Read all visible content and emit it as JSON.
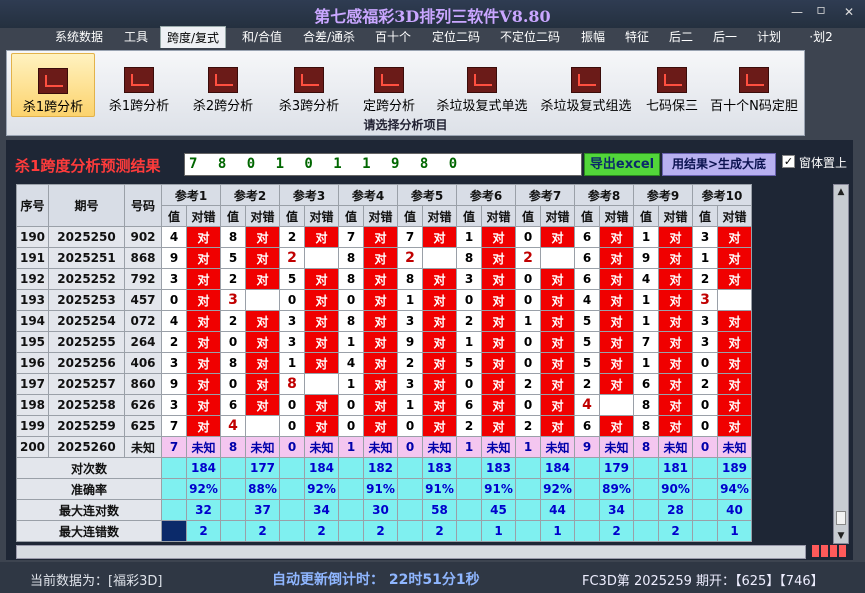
{
  "window": {
    "title": "第七感福彩3D排列三软件V8.80",
    "minimize": "—",
    "restore": "▫",
    "close": "✕"
  },
  "menu": [
    "系统数据",
    "工具",
    "跨度/复式",
    "和/合值",
    "合差/通杀",
    "百十个",
    "定位二码",
    "不定位二码",
    "振幅",
    "特征",
    "后二",
    "后一",
    "计划",
    "·划2"
  ],
  "menu_active": "跨度/复式",
  "ribbon": {
    "buttons": [
      "杀1跨分析",
      "杀1跨分析",
      "杀2跨分析",
      "杀3跨分析",
      "定跨分析",
      "杀垃圾复式单选",
      "杀垃圾复式组选",
      "七码保三",
      "百十个N码定胆"
    ],
    "selected": "杀1跨分析",
    "caption": "请选择分析项目"
  },
  "result": {
    "label": "杀1跨度分析预测结果",
    "value": "7 8 0 1 0 1 1 9 8 0",
    "excel_button": "导出excel",
    "generate_button": "用结果>生成大底",
    "pin_label": "窗体置上",
    "pin_checked": "✓"
  },
  "table": {
    "headers": {
      "seq": "序号",
      "issue": "期号",
      "number": "号码",
      "val": "值",
      "ok": "对错"
    },
    "refs": [
      "参考1",
      "参考2",
      "参考3",
      "参考4",
      "参考5",
      "参考6",
      "参考7",
      "参考8",
      "参考9",
      "参考10"
    ],
    "rows": [
      {
        "seq": "190",
        "issue": "2025250",
        "number": "902",
        "cells": [
          [
            "4",
            "对"
          ],
          [
            "8",
            "对"
          ],
          [
            "2",
            "对"
          ],
          [
            "7",
            "对"
          ],
          [
            "7",
            "对"
          ],
          [
            "1",
            "对"
          ],
          [
            "0",
            "对"
          ],
          [
            "6",
            "对"
          ],
          [
            "1",
            "对"
          ],
          [
            "3",
            "对"
          ]
        ]
      },
      {
        "seq": "191",
        "issue": "2025251",
        "number": "868",
        "cells": [
          [
            "9",
            "对"
          ],
          [
            "5",
            "对"
          ],
          [
            "2",
            ""
          ],
          [
            "8",
            "对"
          ],
          [
            "2",
            ""
          ],
          [
            "8",
            "对"
          ],
          [
            "2",
            ""
          ],
          [
            "6",
            "对"
          ],
          [
            "9",
            "对"
          ],
          [
            "1",
            "对"
          ]
        ]
      },
      {
        "seq": "192",
        "issue": "2025252",
        "number": "792",
        "cells": [
          [
            "3",
            "对"
          ],
          [
            "2",
            "对"
          ],
          [
            "5",
            "对"
          ],
          [
            "8",
            "对"
          ],
          [
            "8",
            "对"
          ],
          [
            "3",
            "对"
          ],
          [
            "0",
            "对"
          ],
          [
            "6",
            "对"
          ],
          [
            "4",
            "对"
          ],
          [
            "2",
            "对"
          ]
        ]
      },
      {
        "seq": "193",
        "issue": "2025253",
        "number": "457",
        "cells": [
          [
            "0",
            "对"
          ],
          [
            "3",
            ""
          ],
          [
            "0",
            "对"
          ],
          [
            "0",
            "对"
          ],
          [
            "1",
            "对"
          ],
          [
            "0",
            "对"
          ],
          [
            "0",
            "对"
          ],
          [
            "4",
            "对"
          ],
          [
            "1",
            "对"
          ],
          [
            "3",
            ""
          ]
        ]
      },
      {
        "seq": "194",
        "issue": "2025254",
        "number": "072",
        "cells": [
          [
            "4",
            "对"
          ],
          [
            "2",
            "对"
          ],
          [
            "3",
            "对"
          ],
          [
            "8",
            "对"
          ],
          [
            "3",
            "对"
          ],
          [
            "2",
            "对"
          ],
          [
            "1",
            "对"
          ],
          [
            "5",
            "对"
          ],
          [
            "1",
            "对"
          ],
          [
            "3",
            "对"
          ]
        ]
      },
      {
        "seq": "195",
        "issue": "2025255",
        "number": "264",
        "cells": [
          [
            "2",
            "对"
          ],
          [
            "0",
            "对"
          ],
          [
            "3",
            "对"
          ],
          [
            "1",
            "对"
          ],
          [
            "9",
            "对"
          ],
          [
            "1",
            "对"
          ],
          [
            "0",
            "对"
          ],
          [
            "5",
            "对"
          ],
          [
            "7",
            "对"
          ],
          [
            "3",
            "对"
          ]
        ]
      },
      {
        "seq": "196",
        "issue": "2025256",
        "number": "406",
        "cells": [
          [
            "3",
            "对"
          ],
          [
            "8",
            "对"
          ],
          [
            "1",
            "对"
          ],
          [
            "4",
            "对"
          ],
          [
            "2",
            "对"
          ],
          [
            "5",
            "对"
          ],
          [
            "0",
            "对"
          ],
          [
            "5",
            "对"
          ],
          [
            "1",
            "对"
          ],
          [
            "0",
            "对"
          ]
        ]
      },
      {
        "seq": "197",
        "issue": "2025257",
        "number": "860",
        "cells": [
          [
            "9",
            "对"
          ],
          [
            "0",
            "对"
          ],
          [
            "8",
            ""
          ],
          [
            "1",
            "对"
          ],
          [
            "3",
            "对"
          ],
          [
            "0",
            "对"
          ],
          [
            "2",
            "对"
          ],
          [
            "2",
            "对"
          ],
          [
            "6",
            "对"
          ],
          [
            "2",
            "对"
          ]
        ]
      },
      {
        "seq": "198",
        "issue": "2025258",
        "number": "626",
        "cells": [
          [
            "3",
            "对"
          ],
          [
            "6",
            "对"
          ],
          [
            "0",
            "对"
          ],
          [
            "0",
            "对"
          ],
          [
            "1",
            "对"
          ],
          [
            "6",
            "对"
          ],
          [
            "0",
            "对"
          ],
          [
            "4",
            ""
          ],
          [
            "8",
            "对"
          ],
          [
            "0",
            "对"
          ]
        ]
      },
      {
        "seq": "199",
        "issue": "2025259",
        "number": "625",
        "cells": [
          [
            "7",
            "对"
          ],
          [
            "4",
            ""
          ],
          [
            "0",
            "对"
          ],
          [
            "0",
            "对"
          ],
          [
            "0",
            "对"
          ],
          [
            "2",
            "对"
          ],
          [
            "2",
            "对"
          ],
          [
            "6",
            "对"
          ],
          [
            "8",
            "对"
          ],
          [
            "0",
            "对"
          ]
        ]
      }
    ],
    "predict": {
      "seq": "200",
      "issue": "2025260",
      "number": "未知",
      "vals": [
        "7",
        "8",
        "0",
        "1",
        "0",
        "1",
        "1",
        "9",
        "8",
        "0"
      ],
      "status": "未知"
    },
    "stats": [
      {
        "label": "对次数",
        "vals": [
          "184",
          "177",
          "184",
          "182",
          "183",
          "183",
          "184",
          "179",
          "181",
          "189"
        ]
      },
      {
        "label": "准确率",
        "vals": [
          "92%",
          "88%",
          "92%",
          "91%",
          "91%",
          "91%",
          "92%",
          "89%",
          "90%",
          "94%"
        ]
      },
      {
        "label": "最大连对数",
        "vals": [
          "32",
          "37",
          "34",
          "30",
          "58",
          "45",
          "44",
          "34",
          "28",
          "40"
        ]
      },
      {
        "label": "最大连错数",
        "vals": [
          "2",
          "2",
          "2",
          "2",
          "2",
          "1",
          "1",
          "2",
          "2",
          "1"
        ]
      }
    ]
  },
  "status": {
    "data_source": "当前数据为：[福彩3D]",
    "timer": "自动更新倒计时：  22时51分1秒",
    "issue_info": "FC3D第 2025259 期开：【625】【746】"
  },
  "colors": {
    "hit": "#f00000",
    "miss": "#ffffff",
    "predict": "#f4c6f0",
    "stats": "#7ff0f0"
  }
}
